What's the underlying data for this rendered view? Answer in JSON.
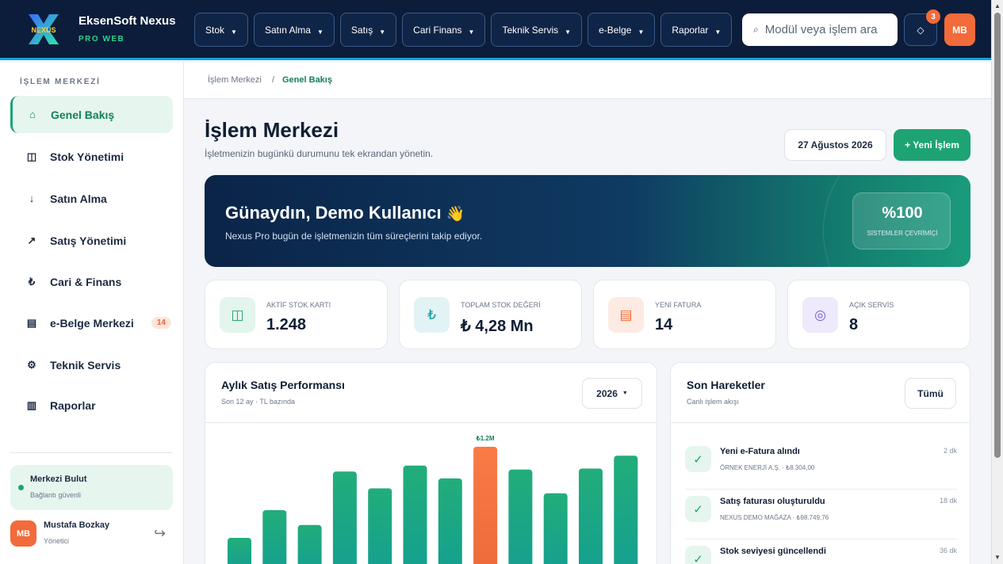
{
  "brand": {
    "logo_text": "NEXUS",
    "name": "EksenSoft Nexus",
    "sub": "PRO WEB"
  },
  "nav": [
    {
      "label": "Stok"
    },
    {
      "label": "Satın Alma"
    },
    {
      "label": "Satış"
    },
    {
      "label": "Cari Finans"
    },
    {
      "label": "Teknik Servis"
    },
    {
      "label": "e-Belge"
    },
    {
      "label": "Raporlar"
    }
  ],
  "search": {
    "placeholder": "Modül veya işlem ara"
  },
  "topbar": {
    "notifications": "3",
    "avatar": "MB"
  },
  "sidebar": {
    "heading": "İŞLEM MERKEZİ",
    "items": [
      {
        "label": "Genel Bakış",
        "icon": "home-icon"
      },
      {
        "label": "Stok Yönetimi",
        "icon": "box-icon"
      },
      {
        "label": "Satın Alma",
        "icon": "arrow-down-icon"
      },
      {
        "label": "Satış Yönetimi",
        "icon": "trend-up-icon"
      },
      {
        "label": "Cari & Finans",
        "icon": "lira-icon"
      },
      {
        "label": "e-Belge Merkezi",
        "icon": "document-icon",
        "badge": "14"
      },
      {
        "label": "Teknik Servis",
        "icon": "gear-icon"
      },
      {
        "label": "Raporlar",
        "icon": "report-icon"
      }
    ],
    "cloud": {
      "title": "Merkezi Bulut",
      "sub": "Bağlantı güvenli"
    },
    "user": {
      "initials": "MB",
      "name": "Mustafa Bozkay",
      "role": "Yönetici"
    }
  },
  "breadcrumb": {
    "root": "İşlem Merkezi",
    "sep": "/",
    "current": "Genel Bakış"
  },
  "header": {
    "title": "İşlem Merkezi",
    "subtitle": "İşletmenizin bugünkü durumunu tek ekrandan yönetin.",
    "date": "27 Ağustos 2026",
    "new_button": "+ Yeni İşlem"
  },
  "hero": {
    "greeting": "Günaydın, Demo Kullanıcı",
    "wave": "👋",
    "sub": "Nexus Pro bugün de işletmenizin tüm süreçlerini takip ediyor.",
    "stat_value": "%100",
    "stat_label": "SİSTEMLER ÇEVRİMİÇİ"
  },
  "kpis": [
    {
      "label": "AKTİF STOK KARTI",
      "value": "1.248",
      "icon": "box-icon"
    },
    {
      "label": "TOPLAM STOK DEĞERİ",
      "value": "₺ 4,28 Mn",
      "icon": "lira-icon"
    },
    {
      "label": "YENİ FATURA",
      "value": "14",
      "icon": "document-icon"
    },
    {
      "label": "AÇIK SERVİS",
      "value": "8",
      "icon": "target-icon"
    }
  ],
  "sales_card": {
    "title": "Aylık Satış Performansı",
    "subtitle": "Son 12 ay · TL bazında",
    "year": "2026"
  },
  "chart_data": {
    "type": "bar",
    "values": [
      0.28,
      0.56,
      0.41,
      0.95,
      0.78,
      1.01,
      0.88,
      1.2,
      0.97,
      0.73,
      0.98,
      1.11
    ],
    "highlight_index": 7,
    "highlight_label": "₺1.2M",
    "colors": {
      "normal": "#1ea374",
      "highlight": "#f26b3a"
    }
  },
  "activity": {
    "title": "Son Hareketler",
    "subtitle": "Canlı işlem akışı",
    "all_button": "Tümü",
    "items": [
      {
        "title": "Yeni e-Fatura alındı",
        "sub": "ÖRNEK ENERJİ A.Ş. · ₺8.304,00",
        "time": "2 dk"
      },
      {
        "title": "Satış faturası oluşturuldu",
        "sub": "NEXUS DEMO MAĞAZA · ₺98.749,76",
        "time": "18 dk"
      },
      {
        "title": "Stok seviyesi güncellendi",
        "sub": "",
        "time": "36 dk"
      }
    ]
  }
}
